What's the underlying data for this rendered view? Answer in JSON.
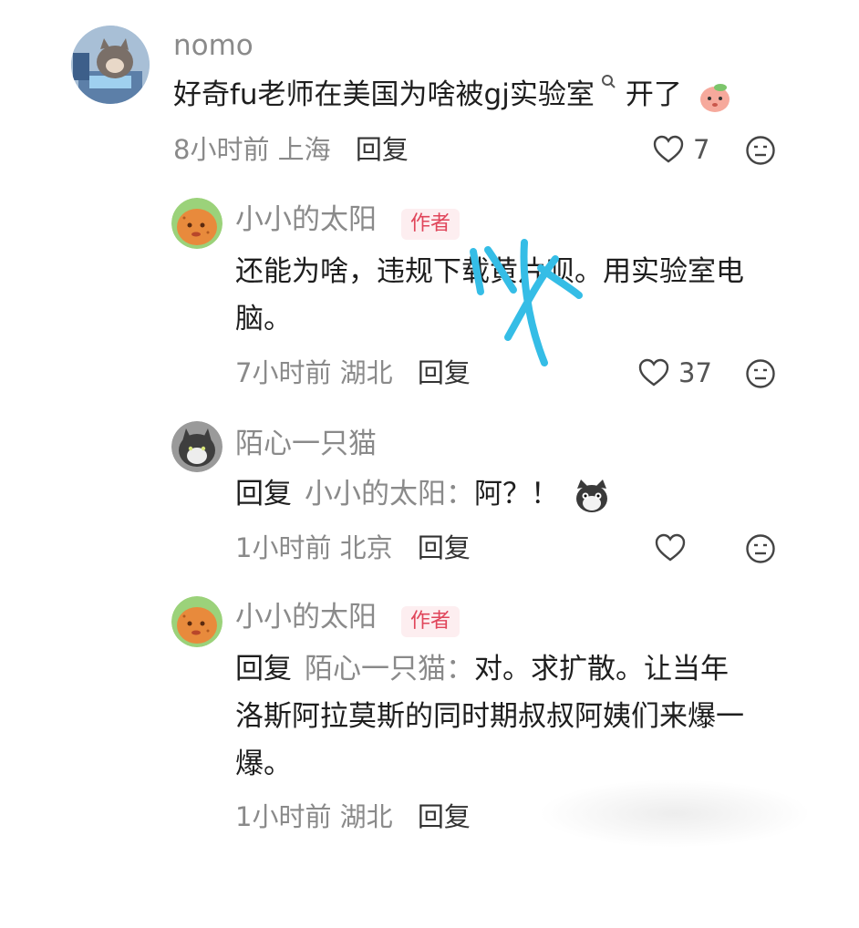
{
  "comments": [
    {
      "user": "nomo",
      "text": "好奇fu老师在美国为啥被gj实验室",
      "text_after": "开了",
      "time": "8小时前",
      "location": "上海",
      "reply_label": "回复",
      "likes": "7"
    },
    {
      "user": "小小的太阳",
      "badge": "作者",
      "text_line1": "还能为啥，违规下载黄片呗。用实验室电",
      "text_line2": "脑。",
      "time": "7小时前",
      "location": "湖北",
      "reply_label": "回复",
      "likes": "37"
    },
    {
      "user": "陌心一只猫",
      "reply_prefix": "回复",
      "reply_target": "小小的太阳：",
      "text": "阿？！",
      "time": "1小时前",
      "location": "北京",
      "reply_label": "回复"
    },
    {
      "user": "小小的太阳",
      "badge": "作者",
      "reply_prefix": "回复",
      "reply_target": "陌心一只猫：",
      "text_line1": "对。求扩散。让当年",
      "text_line2": "洛斯阿拉莫斯的同时期叔叔阿姨们来爆一",
      "text_line3": "爆。",
      "time": "1小时前",
      "location": "湖北",
      "reply_label": "回复"
    }
  ],
  "icons": {
    "like": "heart-outline-icon",
    "dislike": "neutral-face-icon",
    "search_suffix": "search-small-icon",
    "emoji_peach": "peach-emoji",
    "emoji_cat": "angry-cat-emoji"
  },
  "colors": {
    "badge_text": "#e0455a",
    "badge_bg": "#fdeef0",
    "secondary": "#8a8a8a",
    "scribble": "#35bde6"
  }
}
